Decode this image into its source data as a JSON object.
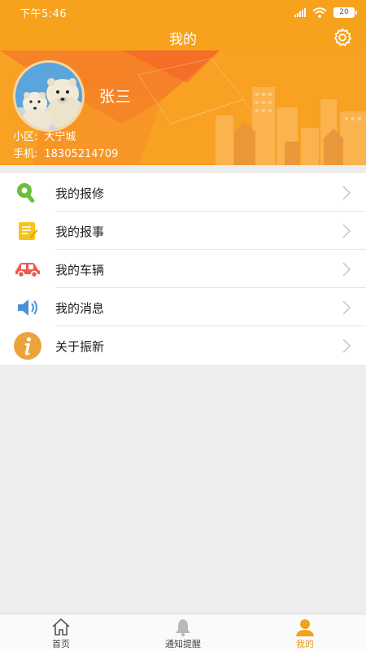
{
  "status": {
    "time": "下午5:46",
    "battery": "20"
  },
  "titlebar": {
    "title": "我的",
    "settings_icon": "gear-icon"
  },
  "profile": {
    "name": "张三",
    "community_label": "小区:",
    "community_value": "大宁城",
    "phone_label": "手机:",
    "phone_value": "18305214709"
  },
  "menu": {
    "items": [
      {
        "label": "我的报修",
        "icon": "wrench-icon"
      },
      {
        "label": "我的报事",
        "icon": "note-icon"
      },
      {
        "label": "我的车辆",
        "icon": "car-icon"
      },
      {
        "label": "我的消息",
        "icon": "speaker-icon"
      },
      {
        "label": "关于振新",
        "icon": "info-icon"
      }
    ]
  },
  "tabbar": {
    "tabs": [
      {
        "label": "首页",
        "icon": "home-icon"
      },
      {
        "label": "通知提醒",
        "icon": "bell-icon"
      },
      {
        "label": "我的",
        "icon": "user-icon",
        "active": true
      }
    ]
  },
  "colors": {
    "accent": "#f7a21c",
    "tab_active": "#e69a1c"
  }
}
